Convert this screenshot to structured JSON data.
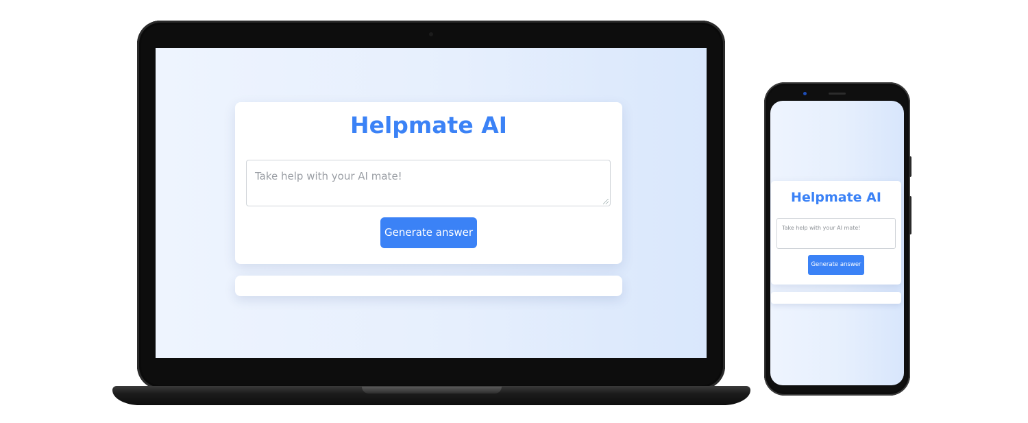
{
  "app": {
    "title": "Helpmate AI",
    "input_placeholder": "Take help with your AI mate!",
    "generate_button_label": "Generate answer",
    "accent_color": "#3b82f6"
  },
  "devices": [
    "laptop",
    "phone"
  ]
}
